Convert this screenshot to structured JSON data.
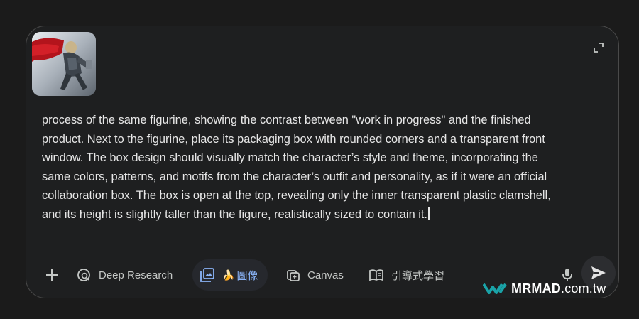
{
  "prompt": {
    "text": "process of the same figurine, showing the contrast between \"work in progress\" and the finished product. Next to the figurine, place its packaging box with rounded corners and a transparent front window. The box design should visually match the character’s style and theme, incorporating the same colors, patterns, and motifs from the character’s outfit and personality, as if it were an official collaboration box. The box is open at the top, revealing only the inner transparent plastic clamshell, and its height is slightly taller than the figure, realistically sized to contain it."
  },
  "attachment": {
    "icon": "thumbnail-image"
  },
  "toolbar": {
    "add_icon": "plus-icon",
    "deep_research_label": "Deep Research",
    "image_label": "圖像",
    "image_emoji": "🍌",
    "canvas_label": "Canvas",
    "guided_learning_label": "引導式學習"
  },
  "watermark": {
    "brand": "MRMAD",
    "domain": ".com.tw"
  },
  "colors": {
    "background": "#1b1b1b",
    "panel": "#1e1f20",
    "accent": "#8ab4f8",
    "watermark_teal": "#1aa3a8"
  }
}
